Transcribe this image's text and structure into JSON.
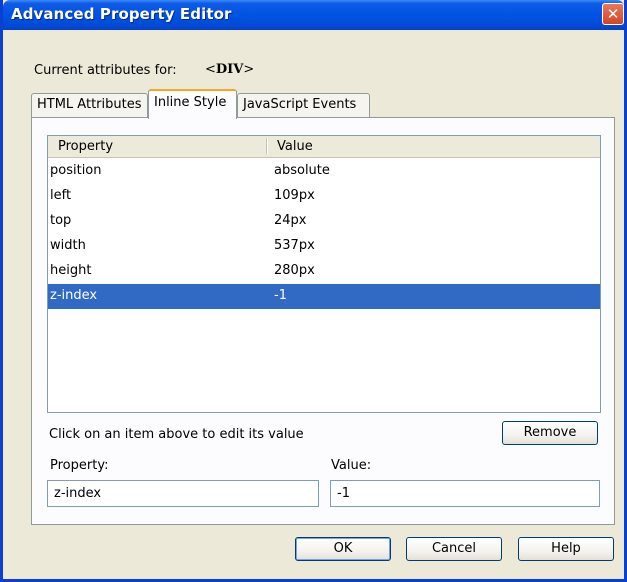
{
  "window": {
    "title": "Advanced Property Editor",
    "close_glyph": "✕"
  },
  "current": {
    "label": "Current attributes for:",
    "tag_open": "<",
    "tag_name": "DIV",
    "tag_close": ">"
  },
  "tabs": [
    {
      "label": "HTML Attributes",
      "active": false
    },
    {
      "label": "Inline Style",
      "active": true
    },
    {
      "label": "JavaScript Events",
      "active": false
    }
  ],
  "grid": {
    "columns": [
      "Property",
      "Value"
    ],
    "rows": [
      {
        "property": "position",
        "value": "absolute",
        "selected": false
      },
      {
        "property": "left",
        "value": "109px",
        "selected": false
      },
      {
        "property": "top",
        "value": "24px",
        "selected": false
      },
      {
        "property": "width",
        "value": "537px",
        "selected": false
      },
      {
        "property": "height",
        "value": "280px",
        "selected": false
      },
      {
        "property": "z-index",
        "value": "-1",
        "selected": true
      }
    ]
  },
  "hint": "Click on an item above to edit its value",
  "remove_label": "Remove",
  "editor": {
    "property_label": "Property:",
    "value_label": "Value:",
    "property_value": "z-index",
    "value_value": "-1"
  },
  "buttons": {
    "ok": "OK",
    "cancel": "Cancel",
    "help": "Help"
  },
  "colors": {
    "title_bar": "#0054e3",
    "selection": "#316ac5",
    "active_tab_accent": "#f5a623",
    "close_button": "#d44524"
  }
}
